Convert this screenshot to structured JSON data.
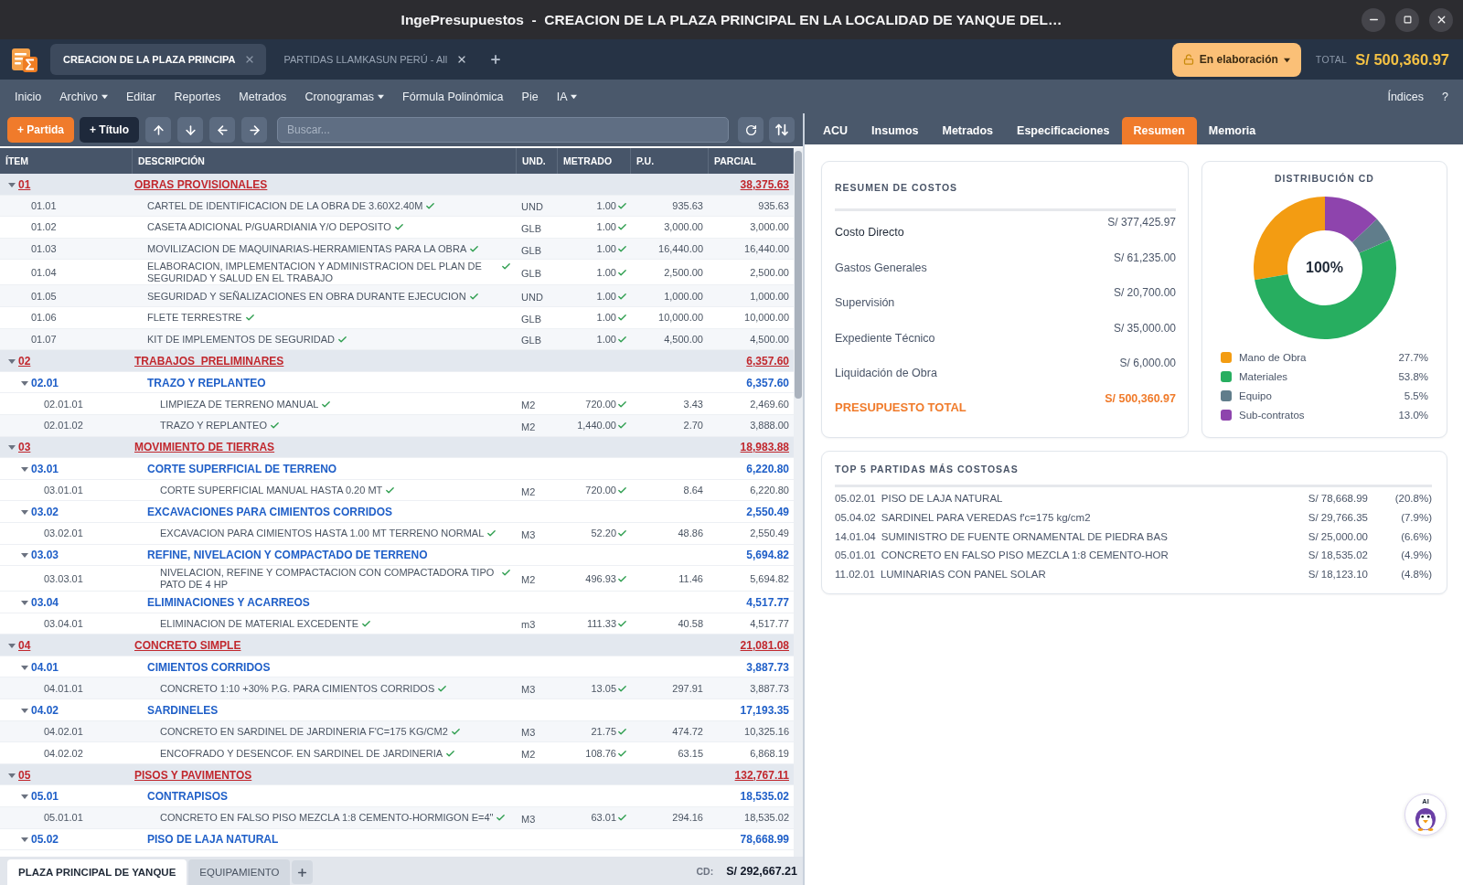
{
  "window": {
    "title": "IngePresupuestos  -  CREACION DE LA PLAZA PRINCIPAL EN LA LOCALIDAD DE YANQUE DEL…"
  },
  "document_tabs": [
    {
      "label": "CREACION DE LA PLAZA PRINCIPA",
      "selected": true
    },
    {
      "label": "PARTIDAS LLAMKASUN PERÚ - All",
      "selected": false
    }
  ],
  "status": {
    "label": "En elaboración"
  },
  "project_total": {
    "label": "TOTAL",
    "value": "S/ 500,360.97"
  },
  "menu": {
    "items": [
      {
        "label": "Inicio",
        "dropdown": false
      },
      {
        "label": "Archivo",
        "dropdown": true
      },
      {
        "label": "Editar",
        "dropdown": false
      },
      {
        "label": "Reportes",
        "dropdown": false
      },
      {
        "label": "Metrados",
        "dropdown": false
      },
      {
        "label": "Cronogramas",
        "dropdown": true
      },
      {
        "label": "Fórmula Polinómica",
        "dropdown": false
      },
      {
        "label": "Pie",
        "dropdown": false
      },
      {
        "label": "IA",
        "dropdown": true
      }
    ],
    "right_items": [
      {
        "label": "Índices"
      },
      {
        "label": "?"
      }
    ]
  },
  "toolbar": {
    "buttons": [
      {
        "label": "+ Partida",
        "kind": "accent"
      },
      {
        "label": "+ Título",
        "kind": "dark"
      }
    ],
    "search": {
      "placeholder": "Buscar..."
    }
  },
  "table": {
    "columns": [
      "ÍTEM",
      "DESCRIPCIÓN",
      "UND.",
      "METRADO",
      "P.U.",
      "PARCIAL"
    ],
    "rows": [
      {
        "kind": "title",
        "item": "01",
        "description": "OBRAS PROVISIONALES",
        "parcial": "38,375.63",
        "expanded": true,
        "children": [
          {
            "kind": "item",
            "item": "01.01",
            "description": "CARTEL DE IDENTIFICACION DE LA OBRA DE 3.60X2.40M",
            "unit": "UND",
            "metrado": "1.00",
            "pu": "935.63",
            "parcial": "935.63",
            "verified": true
          },
          {
            "kind": "item",
            "item": "01.02",
            "description": "CASETA ADICIONAL P/GUARDIANIA Y/O DEPOSITO",
            "unit": "GLB",
            "metrado": "1.00",
            "pu": "3,000.00",
            "parcial": "3,000.00",
            "verified": true
          },
          {
            "kind": "item",
            "item": "01.03",
            "description": "MOVILIZACION DE MAQUINARIAS-HERRAMIENTAS PARA LA OBRA",
            "unit": "GLB",
            "metrado": "1.00",
            "pu": "16,440.00",
            "parcial": "16,440.00",
            "verified": true
          },
          {
            "kind": "item",
            "item": "01.04",
            "description": "ELABORACION, IMPLEMENTACION Y ADMINISTRACION DEL PLAN DE SEGURIDAD Y SALUD EN EL TRABAJO",
            "unit": "GLB",
            "metrado": "1.00",
            "pu": "2,500.00",
            "parcial": "2,500.00",
            "verified": true
          },
          {
            "kind": "item",
            "item": "01.05",
            "description": "SEGURIDAD Y SEÑALIZACIONES EN OBRA DURANTE EJECUCION",
            "unit": "UND",
            "metrado": "1.00",
            "pu": "1,000.00",
            "parcial": "1,000.00",
            "verified": true
          },
          {
            "kind": "item",
            "item": "01.06",
            "description": "FLETE TERRESTRE",
            "unit": "GLB",
            "metrado": "1.00",
            "pu": "10,000.00",
            "parcial": "10,000.00",
            "verified": true
          },
          {
            "kind": "item",
            "item": "01.07",
            "description": "KIT DE IMPLEMENTOS DE SEGURIDAD",
            "unit": "GLB",
            "metrado": "1.00",
            "pu": "4,500.00",
            "parcial": "4,500.00",
            "verified": true
          }
        ]
      },
      {
        "kind": "title",
        "item": "02",
        "description": "TRABAJOS  PRELIMINARES",
        "parcial": "6,357.60",
        "expanded": true,
        "children": [
          {
            "kind": "title",
            "item": "02.01",
            "description": "TRAZO Y REPLANTEO",
            "parcial": "6,357.60",
            "expanded": true,
            "children": [
              {
                "kind": "item",
                "item": "02.01.01",
                "description": "LIMPIEZA DE TERRENO MANUAL",
                "unit": "M2",
                "metrado": "720.00",
                "pu": "3.43",
                "parcial": "2,469.60",
                "verified": true
              },
              {
                "kind": "item",
                "item": "02.01.02",
                "description": "TRAZO Y REPLANTEO",
                "unit": "M2",
                "metrado": "1,440.00",
                "pu": "2.70",
                "parcial": "3,888.00",
                "verified": true
              }
            ]
          }
        ]
      },
      {
        "kind": "title",
        "item": "03",
        "description": "MOVIMIENTO DE TIERRAS",
        "parcial": "18,983.88",
        "expanded": true,
        "children": [
          {
            "kind": "title",
            "item": "03.01",
            "description": "CORTE SUPERFICIAL DE TERRENO",
            "parcial": "6,220.80",
            "expanded": true,
            "children": [
              {
                "kind": "item",
                "item": "03.01.01",
                "description": "CORTE SUPERFICIAL MANUAL HASTA 0.20 MT",
                "unit": "M2",
                "metrado": "720.00",
                "pu": "8.64",
                "parcial": "6,220.80",
                "verified": true
              }
            ]
          },
          {
            "kind": "title",
            "item": "03.02",
            "description": "EXCAVACIONES PARA CIMIENTOS CORRIDOS",
            "parcial": "2,550.49",
            "expanded": true,
            "children": [
              {
                "kind": "item",
                "item": "03.02.01",
                "description": "EXCAVACION PARA CIMIENTOS HASTA 1.00 MT TERRENO NORMAL",
                "unit": "M3",
                "metrado": "52.20",
                "pu": "48.86",
                "parcial": "2,550.49",
                "verified": true
              }
            ]
          },
          {
            "kind": "title",
            "item": "03.03",
            "description": "REFINE, NIVELACION Y COMPACTADO DE TERRENO",
            "parcial": "5,694.82",
            "expanded": true,
            "children": [
              {
                "kind": "item",
                "item": "03.03.01",
                "description": "NIVELACION, REFINE Y COMPACTACION CON COMPACTADORA TIPO PATO DE 4 HP",
                "unit": "M2",
                "metrado": "496.93",
                "pu": "11.46",
                "parcial": "5,694.82",
                "verified": true
              }
            ]
          },
          {
            "kind": "title",
            "item": "03.04",
            "description": "ELIMINACIONES Y ACARREOS",
            "parcial": "4,517.77",
            "expanded": true,
            "children": [
              {
                "kind": "item",
                "item": "03.04.01",
                "description": "ELIMINACION DE MATERIAL EXCEDENTE",
                "unit": "m3",
                "metrado": "111.33",
                "pu": "40.58",
                "parcial": "4,517.77",
                "verified": true
              }
            ]
          }
        ]
      },
      {
        "kind": "title",
        "item": "04",
        "description": "CONCRETO SIMPLE",
        "parcial": "21,081.08",
        "expanded": true,
        "children": [
          {
            "kind": "title",
            "item": "04.01",
            "description": "CIMIENTOS CORRIDOS",
            "parcial": "3,887.73",
            "expanded": true,
            "children": [
              {
                "kind": "item",
                "item": "04.01.01",
                "description": "CONCRETO 1:10 +30% P.G. PARA CIMIENTOS CORRIDOS",
                "unit": "M3",
                "metrado": "13.05",
                "pu": "297.91",
                "parcial": "3,887.73",
                "verified": true
              }
            ]
          },
          {
            "kind": "title",
            "item": "04.02",
            "description": "SARDINELES",
            "parcial": "17,193.35",
            "expanded": true,
            "children": [
              {
                "kind": "item",
                "item": "04.02.01",
                "description": "CONCRETO EN SARDINEL DE JARDINERIA F'C=175 KG/CM2",
                "unit": "M3",
                "metrado": "21.75",
                "pu": "474.72",
                "parcial": "10,325.16",
                "verified": true
              },
              {
                "kind": "item",
                "item": "04.02.02",
                "description": "ENCOFRADO Y DESENCOF. EN SARDINEL DE JARDINERIA",
                "unit": "M2",
                "metrado": "108.76",
                "pu": "63.15",
                "parcial": "6,868.19",
                "verified": true
              }
            ]
          }
        ]
      },
      {
        "kind": "title",
        "item": "05",
        "description": "PISOS Y PAVIMENTOS",
        "parcial": "132,767.11",
        "expanded": true,
        "children": [
          {
            "kind": "title",
            "item": "05.01",
            "description": "CONTRAPISOS",
            "parcial": "18,535.02",
            "expanded": true,
            "children": [
              {
                "kind": "item",
                "item": "05.01.01",
                "description": "CONCRETO EN FALSO PISO MEZCLA 1:8 CEMENTO-HORMIGON E=4\"",
                "unit": "M3",
                "metrado": "63.01",
                "pu": "294.16",
                "parcial": "18,535.02",
                "verified": true
              }
            ]
          },
          {
            "kind": "title",
            "item": "05.02",
            "description": "PISO DE LAJA NATURAL",
            "parcial": "78,668.99",
            "expanded": true
          }
        ]
      }
    ]
  },
  "sheet_tabs": [
    {
      "label": "PLAZA PRINCIPAL DE YANQUE",
      "selected": true
    },
    {
      "label": "EQUIPAMIENTO",
      "selected": false
    }
  ],
  "direct_cost": {
    "label": "CD:",
    "value": "S/ 292,667.21"
  },
  "panel_tabs": [
    {
      "label": "ACU",
      "selected": false
    },
    {
      "label": "Insumos",
      "selected": false
    },
    {
      "label": "Metrados",
      "selected": false
    },
    {
      "label": "Especificaciones",
      "selected": false
    },
    {
      "label": "Resumen",
      "selected": true
    },
    {
      "label": "Memoria",
      "selected": false
    }
  ],
  "cost_summary": {
    "title": "RESUMEN DE COSTOS",
    "rows": [
      {
        "label": "Costo Directo",
        "value": "S/ 377,425.97",
        "kind": "highlight"
      },
      {
        "label": "Gastos Generales",
        "value": "S/ 61,235.00",
        "kind": "normal"
      },
      {
        "label": "Supervisión",
        "value": "S/ 20,700.00",
        "kind": "normal"
      },
      {
        "label": "Expediente Técnico",
        "value": "S/ 35,000.00",
        "kind": "normal"
      },
      {
        "label": "Liquidación de Obra",
        "value": "S/ 6,000.00",
        "kind": "normal"
      },
      {
        "label": "PRESUPUESTO TOTAL",
        "value": "S/ 500,360.97",
        "kind": "total"
      }
    ]
  },
  "distribution": {
    "center_label": "100%",
    "legend": [
      {
        "percent": "27.7%",
        "color": "#f39c12"
      },
      {
        "percent": "53.8%",
        "color": "#27ae60"
      },
      {
        "percent": "5.5%",
        "color": "#607d8b"
      },
      {
        "percent": "13.0%",
        "color": "#8e44ad"
      }
    ],
    "chart_data": {
      "type": "donut",
      "title": "DISTRIBUCIÓN CD",
      "categories": [
        "Mano de Obra",
        "Materiales",
        "Equipo",
        "Sub-contratos"
      ],
      "values": [
        27.7,
        53.8,
        5.5,
        13.0
      ]
    }
  },
  "top_items": {
    "title": "TOP 5 PARTIDAS MÁS COSTOSAS",
    "rows": [
      {
        "code": "05.02.01",
        "description": "PISO DE LAJA NATURAL",
        "amount": "S/ 78,668.99",
        "share": "(20.8%)"
      },
      {
        "code": "05.04.02",
        "description": "SARDINEL PARA VEREDAS f'c=175 kg/cm2",
        "amount": "S/ 29,766.35",
        "share": "(7.9%)"
      },
      {
        "code": "14.01.04",
        "description": "SUMINISTRO DE FUENTE ORNAMENTAL DE PIEDRA BAS",
        "amount": "S/ 25,000.00",
        "share": "(6.6%)"
      },
      {
        "code": "05.01.01",
        "description": "CONCRETO EN FALSO PISO MEZCLA 1:8 CEMENTO-HOR",
        "amount": "S/ 18,535.02",
        "share": "(4.9%)"
      },
      {
        "code": "11.02.01",
        "description": "LUMINARIAS CON PANEL SOLAR",
        "amount": "S/ 18,123.10",
        "share": "(4.8%)"
      }
    ]
  },
  "assistant": {
    "label": "AI"
  }
}
